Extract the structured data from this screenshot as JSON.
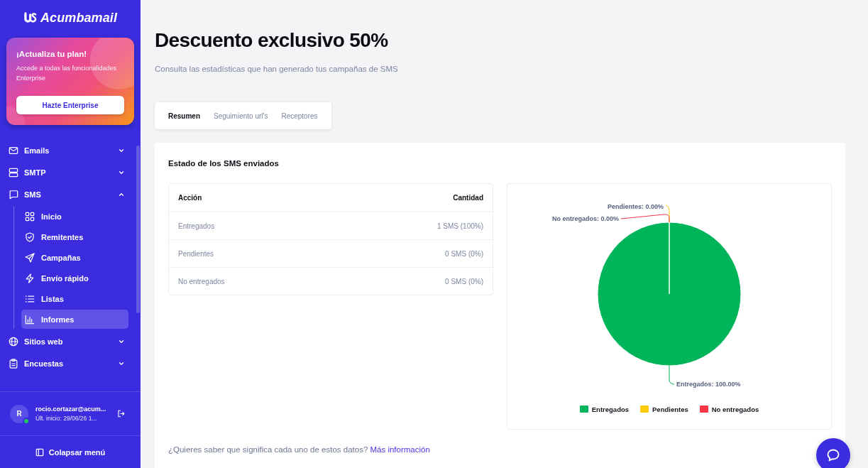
{
  "sidebar": {
    "logo": "Acumbamail",
    "promo": {
      "title": "¡Actualiza tu plan!",
      "text": "Accede a todas las funcionalidades Enterprise",
      "button": "Hazte Enterprise"
    },
    "nav": [
      {
        "label": "Emails",
        "expanded": false
      },
      {
        "label": "SMTP",
        "expanded": false
      },
      {
        "label": "SMS",
        "expanded": true,
        "children": [
          {
            "label": "Inicio",
            "selected": false
          },
          {
            "label": "Remitentes",
            "selected": false
          },
          {
            "label": "Campañas",
            "selected": false
          },
          {
            "label": "Envío rápido",
            "selected": false
          },
          {
            "label": "Listas",
            "selected": false
          },
          {
            "label": "Informes",
            "selected": true
          }
        ]
      },
      {
        "label": "Sitios web",
        "expanded": false
      },
      {
        "label": "Encuestas",
        "expanded": false
      }
    ],
    "user": {
      "initial": "R",
      "online": true,
      "email": "rocio.cortazar@acum...",
      "last_login": "Últ. inicio: 29/06/26 1..."
    },
    "collapse": "Colapsar menú"
  },
  "header": {
    "title": "Descuento exclusivo 50%",
    "subtitle": "Consulta las estadísticas que han generado tus campañas de SMS"
  },
  "tabs": [
    {
      "label": "Resumen",
      "selected": true
    },
    {
      "label": "Seguimiento url's",
      "selected": false
    },
    {
      "label": "Receptores",
      "selected": false
    }
  ],
  "panel": {
    "title": "Estado de los SMS enviados",
    "table": {
      "columns": [
        "Acción",
        "Cantidad"
      ],
      "rows": [
        [
          "Entregados",
          "1 SMS (100%)"
        ],
        [
          "Pendientes",
          "0 SMS (0%)"
        ],
        [
          "No entregados",
          "0 SMS (0%)"
        ]
      ]
    },
    "chart": {
      "chart_data": {
        "type": "pie",
        "values": [
          100,
          0,
          0
        ],
        "value_labels": [
          "Entregados: 100.00%",
          "Pendientes: 0.00%",
          "No entregados: 0.00%"
        ]
      },
      "legend": [
        {
          "label": "Entregados",
          "color": "#00b45a"
        },
        {
          "label": "Pendientes",
          "color": "#ffcb05"
        },
        {
          "label": "No entregados",
          "color": "#f5364a"
        }
      ]
    },
    "help": {
      "text": "¿Quieres saber que significa cada uno de estos datos?",
      "link": "Más información"
    }
  }
}
